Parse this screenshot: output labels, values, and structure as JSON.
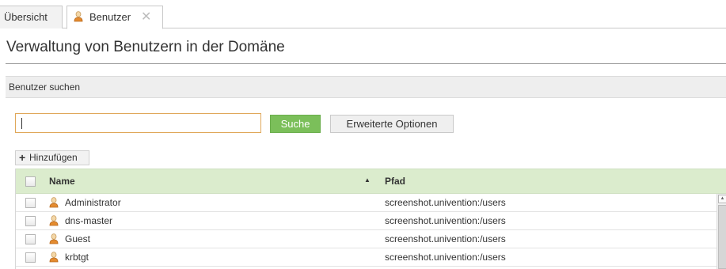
{
  "tabs": [
    {
      "label": "Übersicht"
    },
    {
      "label": "Benutzer",
      "icon": "user-icon",
      "closable": true
    }
  ],
  "page": {
    "title": "Verwaltung von Benutzern in der Domäne"
  },
  "search": {
    "section_title": "Benutzer suchen",
    "input_value": "",
    "search_button": "Suche",
    "advanced_button": "Erweiterte Optionen"
  },
  "toolbar": {
    "add_label": "Hinzufügen"
  },
  "grid": {
    "columns": [
      {
        "label": "Name",
        "sorted": "ascending"
      },
      {
        "label": "Pfad"
      }
    ],
    "rows": [
      {
        "name": "Administrator",
        "path": "screenshot.univention:/users"
      },
      {
        "name": "dns-master",
        "path": "screenshot.univention:/users"
      },
      {
        "name": "Guest",
        "path": "screenshot.univention:/users"
      },
      {
        "name": "krbtgt",
        "path": "screenshot.univention:/users"
      }
    ]
  },
  "colors": {
    "accent_green": "#7bbf5a",
    "header_green": "#dbeccd",
    "input_border": "#e0a85a"
  }
}
